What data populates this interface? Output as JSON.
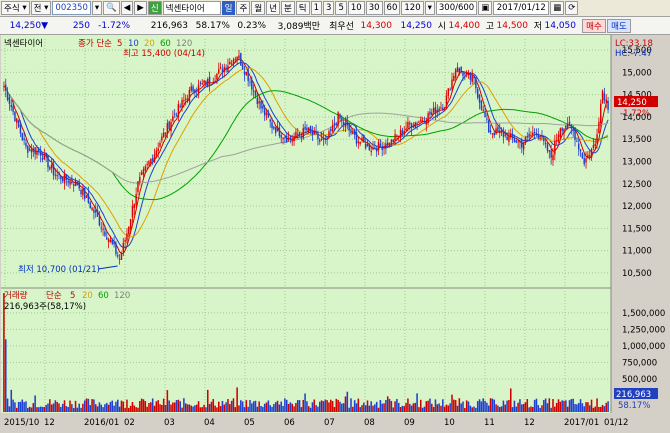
{
  "toolbar": {
    "market": "주식",
    "all_label": "전",
    "stock_code": "002350",
    "stock_name": "넥센타이어",
    "weekly_flag": "일",
    "periods": [
      "주",
      "월",
      "년",
      "분",
      "틱"
    ],
    "minute_steps": [
      "1",
      "3",
      "5",
      "10",
      "30",
      "60",
      "120"
    ],
    "count": "300/600",
    "date": "2017/01/12",
    "buy_label": "매수",
    "sell_label": "매도"
  },
  "quote": {
    "price": "14,250",
    "change": "250",
    "change_pct": "-1.72%",
    "volume": "216,963",
    "volume_ratio": "58.17%",
    "turnover": "0.23%",
    "amount": "3,089백만",
    "pref_label": "최우선",
    "pref_value": "14,300",
    "bid": "14,250",
    "open_label": "시",
    "open": "14,400",
    "high_label": "고",
    "high": "14,500",
    "low_label": "저",
    "low": "14,050"
  },
  "price_panel": {
    "legend_name": "넥센타이어",
    "legend_ma_label": "종가 단순",
    "ma_periods": [
      "5",
      "10",
      "20",
      "60",
      "120"
    ],
    "ma_colors": [
      "#d00000",
      "#1f3fd0",
      "#e0a000",
      "#00a000",
      "#a0a0a0"
    ],
    "lc_label": "LC:33.18",
    "hc_label": "HC:-7.47",
    "high_annot": "최고 15,400 (04/14)",
    "low_annot": "최저 10,700 (01/21)",
    "current_price": "14,250",
    "current_pct": "-1.72%"
  },
  "volume_panel": {
    "legend_name": "거래량",
    "legend_ma_label": "단순",
    "ma_periods": [
      "5",
      "20",
      "60",
      "120"
    ],
    "volume_label": "216,963주(58,17%)",
    "current_volume": "216,963",
    "current_pct": "58.17%"
  },
  "x_axis": {
    "labels": [
      "2015/10",
      "12",
      "2016/01",
      "02",
      "03",
      "04",
      "05",
      "06",
      "07",
      "08",
      "09",
      "10",
      "11",
      "12",
      "2017/01",
      "01/12"
    ]
  },
  "chart_data": [
    {
      "type": "candlestick",
      "name": "price",
      "ylim": [
        10250,
        15750
      ],
      "y_ticks": [
        10500,
        11000,
        11500,
        12000,
        12500,
        13000,
        13500,
        14000,
        14500,
        15000,
        15500
      ],
      "anchors": [
        {
          "t": 0,
          "v": 14700
        },
        {
          "t": 6,
          "v": 14000
        },
        {
          "t": 12,
          "v": 13300
        },
        {
          "t": 20,
          "v": 13200
        },
        {
          "t": 28,
          "v": 12700
        },
        {
          "t": 40,
          "v": 12500
        },
        {
          "t": 50,
          "v": 11800
        },
        {
          "t": 58,
          "v": 11200
        },
        {
          "t": 63,
          "v": 10800
        },
        {
          "t": 67,
          "v": 11400
        },
        {
          "t": 73,
          "v": 12500
        },
        {
          "t": 82,
          "v": 13200
        },
        {
          "t": 92,
          "v": 14000
        },
        {
          "t": 102,
          "v": 14600
        },
        {
          "t": 112,
          "v": 14800
        },
        {
          "t": 122,
          "v": 15200
        },
        {
          "t": 127,
          "v": 15400
        },
        {
          "t": 133,
          "v": 14900
        },
        {
          "t": 140,
          "v": 14200
        },
        {
          "t": 146,
          "v": 13800
        },
        {
          "t": 155,
          "v": 13500
        },
        {
          "t": 165,
          "v": 13700
        },
        {
          "t": 175,
          "v": 13400
        },
        {
          "t": 182,
          "v": 14000
        },
        {
          "t": 192,
          "v": 13500
        },
        {
          "t": 200,
          "v": 13300
        },
        {
          "t": 210,
          "v": 13400
        },
        {
          "t": 220,
          "v": 13800
        },
        {
          "t": 230,
          "v": 14000
        },
        {
          "t": 240,
          "v": 14300
        },
        {
          "t": 246,
          "v": 15100
        },
        {
          "t": 256,
          "v": 14800
        },
        {
          "t": 264,
          "v": 13700
        },
        {
          "t": 272,
          "v": 13600
        },
        {
          "t": 282,
          "v": 13400
        },
        {
          "t": 290,
          "v": 13700
        },
        {
          "t": 298,
          "v": 13100
        },
        {
          "t": 303,
          "v": 13800
        },
        {
          "t": 310,
          "v": 13700
        },
        {
          "t": 316,
          "v": 13000
        },
        {
          "t": 322,
          "v": 13400
        },
        {
          "t": 326,
          "v": 14600
        },
        {
          "t": 329,
          "v": 14250
        }
      ]
    },
    {
      "type": "bar",
      "name": "volume",
      "ylim": [
        0,
        1800000
      ],
      "y_ticks": [
        500000,
        750000,
        1000000,
        1250000,
        1500000
      ]
    }
  ]
}
